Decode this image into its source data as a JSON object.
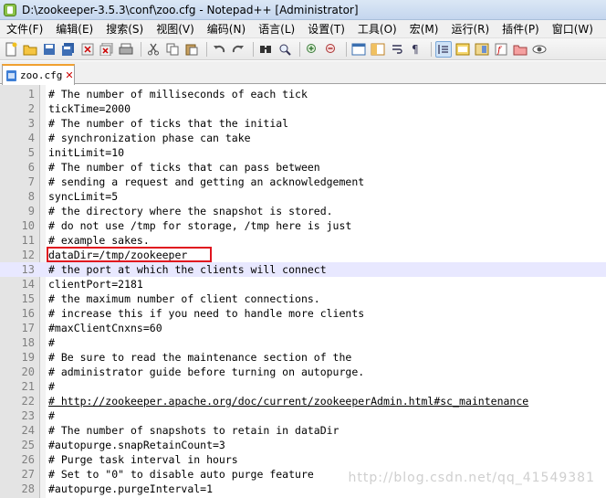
{
  "window": {
    "title": "D:\\zookeeper-3.5.3\\conf\\zoo.cfg - Notepad++ [Administrator]"
  },
  "menu": [
    "文件(F)",
    "编辑(E)",
    "搜索(S)",
    "视图(V)",
    "编码(N)",
    "语言(L)",
    "设置(T)",
    "工具(O)",
    "宏(M)",
    "运行(R)",
    "插件(P)",
    "窗口(W)",
    "?"
  ],
  "toolbar_icons": [
    "new-file-icon",
    "open-file-icon",
    "save-icon",
    "save-all-icon",
    "close-icon",
    "close-all-icon",
    "print-icon",
    "cut-icon",
    "copy-icon",
    "paste-icon",
    "undo-icon",
    "redo-icon",
    "find-icon",
    "replace-icon",
    "zoom-in-icon",
    "zoom-out-icon",
    "sync-vertical-icon",
    "sync-horizontal-icon",
    "word-wrap-icon",
    "show-all-chars-icon",
    "indent-guide-icon",
    "udl-icon",
    "doc-map-icon",
    "function-list-icon",
    "folder-workspace-icon",
    "monitor-icon"
  ],
  "tab": {
    "label": "zoo.cfg",
    "close": "✕"
  },
  "editor": {
    "current_line": 13,
    "highlighted_line": 12,
    "lines": [
      {
        "n": "1",
        "text": "# The number of milliseconds of each tick"
      },
      {
        "n": "2",
        "text": "tickTime=2000"
      },
      {
        "n": "3",
        "text": "# The number of ticks that the initial"
      },
      {
        "n": "4",
        "text": "# synchronization phase can take"
      },
      {
        "n": "5",
        "text": "initLimit=10"
      },
      {
        "n": "6",
        "text": "# The number of ticks that can pass between"
      },
      {
        "n": "7",
        "text": "# sending a request and getting an acknowledgement"
      },
      {
        "n": "8",
        "text": "syncLimit=5"
      },
      {
        "n": "9",
        "text": "# the directory where the snapshot is stored."
      },
      {
        "n": "10",
        "text": "# do not use /tmp for storage, /tmp here is just"
      },
      {
        "n": "11",
        "text": "# example sakes."
      },
      {
        "n": "12",
        "text": "dataDir=/tmp/zookeeper"
      },
      {
        "n": "13",
        "text": "# the port at which the clients will connect"
      },
      {
        "n": "14",
        "text": "clientPort=2181"
      },
      {
        "n": "15",
        "text": "# the maximum number of client connections."
      },
      {
        "n": "16",
        "text": "# increase this if you need to handle more clients"
      },
      {
        "n": "17",
        "text": "#maxClientCnxns=60"
      },
      {
        "n": "18",
        "text": "#"
      },
      {
        "n": "19",
        "text": "# Be sure to read the maintenance section of the"
      },
      {
        "n": "20",
        "text": "# administrator guide before turning on autopurge."
      },
      {
        "n": "21",
        "text": "#"
      },
      {
        "n": "22",
        "text": "# http://zookeeper.apache.org/doc/current/zookeeperAdmin.html#sc_maintenance"
      },
      {
        "n": "23",
        "text": "#"
      },
      {
        "n": "24",
        "text": "# The number of snapshots to retain in dataDir"
      },
      {
        "n": "25",
        "text": "#autopurge.snapRetainCount=3"
      },
      {
        "n": "26",
        "text": "# Purge task interval in hours"
      },
      {
        "n": "27",
        "text": "# Set to \"0\" to disable auto purge feature"
      },
      {
        "n": "28",
        "text": "#autopurge.purgeInterval=1"
      }
    ]
  },
  "watermark": "http://blog.csdn.net/qq_41549381"
}
